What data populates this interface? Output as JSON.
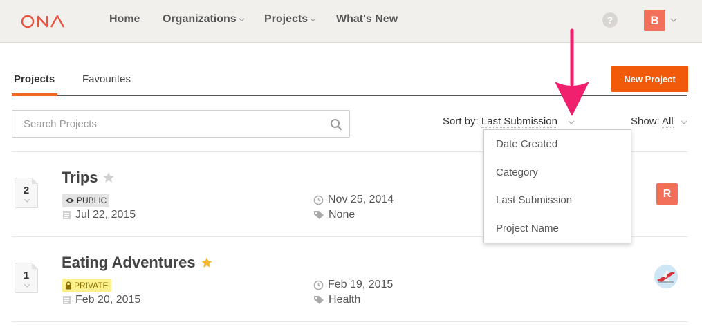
{
  "nav": {
    "brand": "ONA",
    "items": [
      {
        "label": "Home",
        "has_menu": false
      },
      {
        "label": "Organizations",
        "has_menu": true
      },
      {
        "label": "Projects",
        "has_menu": true
      },
      {
        "label": "What's New",
        "has_menu": false
      }
    ],
    "help_glyph": "?",
    "user_initial": "B"
  },
  "tabs": [
    {
      "label": "Projects",
      "active": true
    },
    {
      "label": "Favourites",
      "active": false
    }
  ],
  "new_project_label": "New Project",
  "search": {
    "placeholder": "Search Projects",
    "value": ""
  },
  "sort": {
    "label": "Sort by:",
    "value": "Last Submission"
  },
  "show": {
    "label": "Show:",
    "value": "All"
  },
  "sort_menu": {
    "options": [
      "Date Created",
      "Category",
      "Last Submission",
      "Project Name"
    ]
  },
  "projects": [
    {
      "count": "2",
      "name": "Trips",
      "starred": false,
      "visibility": "PUBLIC",
      "submitted_date": "Jul 22, 2015",
      "created_date": "Nov 25, 2014",
      "category": "None",
      "owner_initial": "R"
    },
    {
      "count": "1",
      "name": "Eating Adventures",
      "starred": true,
      "visibility": "PRIVATE",
      "submitted_date": "Feb 20, 2015",
      "created_date": "Feb 19, 2015",
      "category": "Health",
      "owner_initial": ""
    }
  ],
  "colors": {
    "accent": "#f15a0a",
    "brand": "#e8523f",
    "avatar": "#f26f5a",
    "annotation": "#f0206f",
    "star_active": "#f5b82e",
    "star_inactive": "#d0d0d0"
  }
}
